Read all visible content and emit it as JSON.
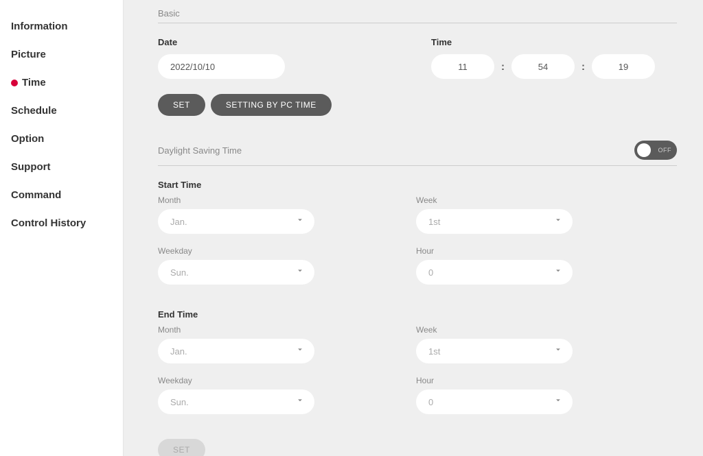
{
  "sidebar": {
    "items": [
      {
        "label": "Information"
      },
      {
        "label": "Picture"
      },
      {
        "label": "Time"
      },
      {
        "label": "Schedule"
      },
      {
        "label": "Option"
      },
      {
        "label": "Support"
      },
      {
        "label": "Command"
      },
      {
        "label": "Control History"
      }
    ],
    "active_index": 2
  },
  "basic": {
    "section_title": "Basic",
    "date_label": "Date",
    "date_value": "2022/10/10",
    "time_label": "Time",
    "hour": "11",
    "minute": "54",
    "second": "19",
    "set_btn": "SET",
    "pc_btn": "SETTING BY PC TIME"
  },
  "dst": {
    "title": "Daylight Saving Time",
    "toggle_state": "OFF",
    "start": {
      "title": "Start Time",
      "month_label": "Month",
      "month_value": "Jan.",
      "week_label": "Week",
      "week_value": "1st",
      "weekday_label": "Weekday",
      "weekday_value": "Sun.",
      "hour_label": "Hour",
      "hour_value": "0"
    },
    "end": {
      "title": "End Time",
      "month_label": "Month",
      "month_value": "Jan.",
      "week_label": "Week",
      "week_value": "1st",
      "weekday_label": "Weekday",
      "weekday_value": "Sun.",
      "hour_label": "Hour",
      "hour_value": "0"
    },
    "set_btn": "SET"
  }
}
